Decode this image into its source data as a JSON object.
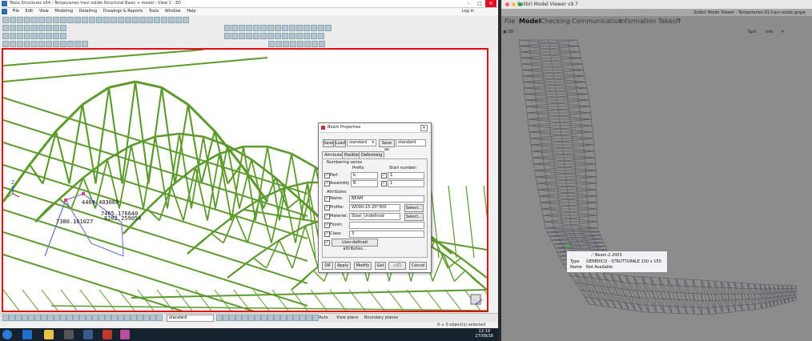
{
  "left_app": {
    "title": "Tekla Structures x64 - Temporaneo travi solide Structural Basic + model - View 1 - 3D",
    "menu": [
      "File",
      "Edit",
      "View",
      "Modeling",
      "Detailing",
      "Drawings & Reports",
      "Tools",
      "Window",
      "Help"
    ],
    "login": "Log in",
    "annotations": [
      "4469.403068",
      "7465.176640",
      "8202.259054",
      "7380.161027"
    ],
    "axis_label": "Z",
    "status": {
      "selector": "standard",
      "options": [
        "Auto",
        "View plane",
        "Boundary planes"
      ],
      "selection_count": "0 + 0 object(s) selected"
    },
    "clock": {
      "time": "12:19",
      "date": "27/09/16"
    }
  },
  "dialog": {
    "title": "Beam Properties",
    "save": "Save",
    "load": "Load",
    "load_value": "standard",
    "save_as": "Save as",
    "save_as_value": "standard",
    "tabs": [
      "Attributes",
      "Position",
      "Deforming"
    ],
    "numbering_series": "Numbering series",
    "prefix": "Prefix:",
    "start_number": "Start number:",
    "part_label": "Part",
    "part_prefix": "b",
    "part_start": "1",
    "assembly_label": "Assembly",
    "assembly_prefix": "B",
    "assembly_start": "1",
    "attributes": "Attributes",
    "name_label": "Name:",
    "name_value": "BEAM",
    "profile_label": "Profile:",
    "profile_value": "WD00-15-20*300",
    "select": "Select...",
    "material_label": "Material:",
    "material_value": "Steel_Undefined",
    "finish_label": "Finish:",
    "finish_value": "",
    "class_label": "Class:",
    "class_value": "3",
    "uda": "User-defined attributes...",
    "ok": "OK",
    "apply": "Apply",
    "modify": "Modify",
    "get": "Get",
    "toggle": "✓/☐",
    "cancel": "Cancel"
  },
  "right_app": {
    "title": "Solibri Model Viewer v9.7",
    "window_title": "Solibri Model Viewer - Temporaneo 01 travi solide grigie",
    "menu": [
      "File",
      "Model",
      "Checking",
      "Communication",
      "Information Takeoff"
    ],
    "view": "3D",
    "tools": [
      "Spin",
      "Info",
      "▾"
    ],
    "tooltip": {
      "object": "Beam.2.2003",
      "type_label": "Type",
      "type_value": "GENERICO - STRUTTURALE 150 x 150",
      "name_label": "Name",
      "name_value": "Not Available"
    }
  },
  "colors": {
    "truss": "#5c9a2c",
    "viewport_border": "#e01010",
    "wireframe": "#4d4d5a",
    "taskbar": "#16222e"
  }
}
